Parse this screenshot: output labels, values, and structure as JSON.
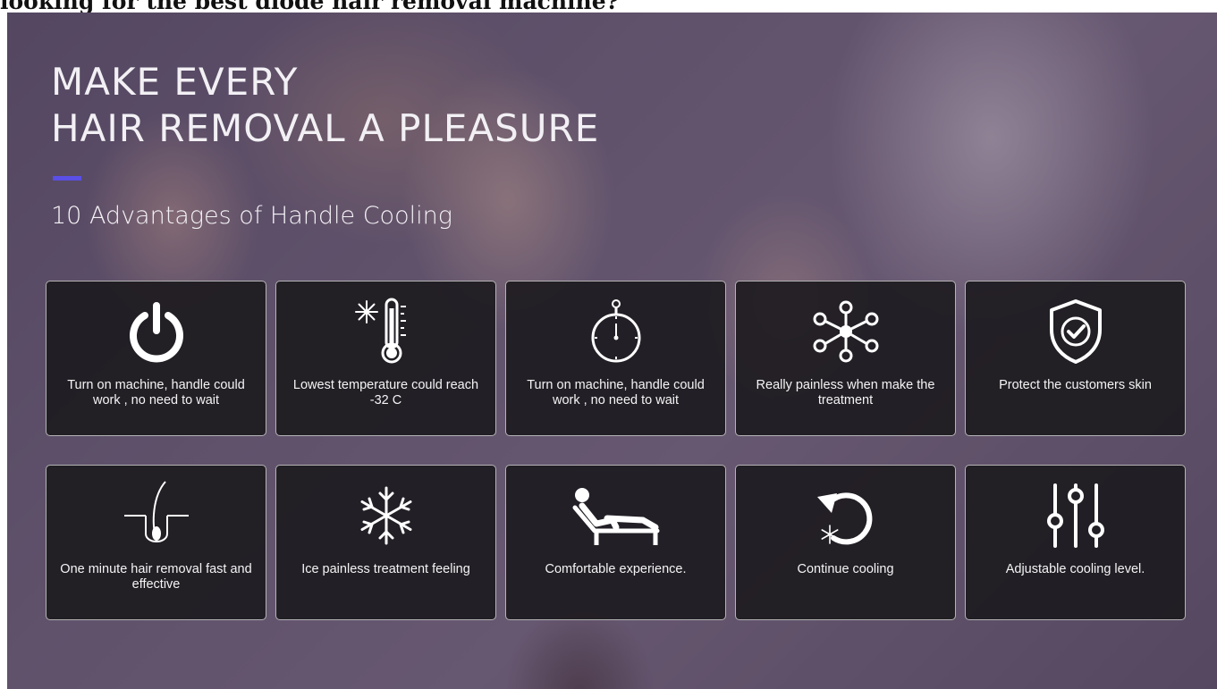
{
  "page": {
    "top_heading": "looking for the best diode hair removal machine?"
  },
  "banner": {
    "headline_line1": "MAKE EVERY",
    "headline_line2": "HAIR REMOVAL A PLEASURE",
    "subtitle": "10 Advantages of Handle Cooling",
    "accent_color": "#5a4fe6"
  },
  "cards": [
    {
      "icon": "power-icon",
      "label": "Turn on machine, handle could work , no need to wait"
    },
    {
      "icon": "thermometer-snowflake-icon",
      "label": "Lowest temperature could reach -32 C"
    },
    {
      "icon": "stopwatch-icon",
      "label": "Turn on machine, handle could work , no need to wait"
    },
    {
      "icon": "network-nodes-icon",
      "label": "Really painless when make the treatment"
    },
    {
      "icon": "shield-check-icon",
      "label": "Protect the customers skin"
    },
    {
      "icon": "hair-follicle-icon",
      "label": "One minute hair removal fast and effective"
    },
    {
      "icon": "snowflake-icon",
      "label": "Ice painless treatment feeling"
    },
    {
      "icon": "reclining-person-icon",
      "label": "Comfortable experience."
    },
    {
      "icon": "rotate-cooling-icon",
      "label": "Continue cooling"
    },
    {
      "icon": "sliders-icon",
      "label": "Adjustable cooling level."
    }
  ]
}
